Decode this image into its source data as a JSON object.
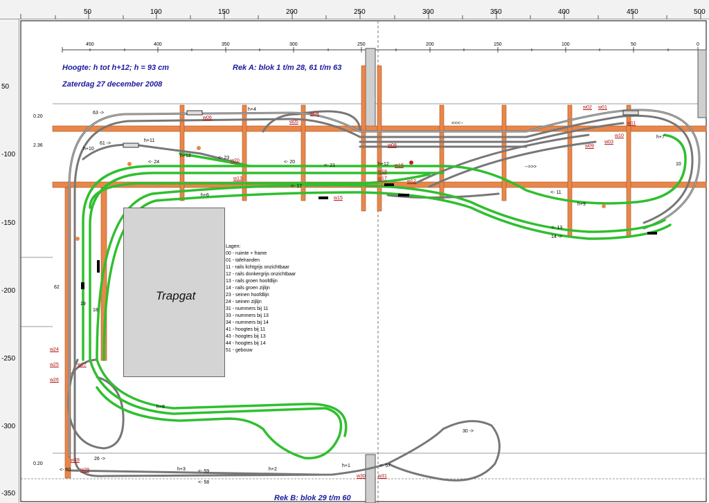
{
  "ruler_top": [
    "50",
    "100",
    "150",
    "200",
    "250",
    "300",
    "350",
    "400",
    "450",
    "500"
  ],
  "ruler_left": [
    "50",
    "-100",
    "-150",
    "-200",
    "-250",
    "-300",
    "-350"
  ],
  "inner_scale": [
    "450",
    "400",
    "350",
    "300",
    "250",
    "200",
    "150",
    "100",
    "50",
    "0"
  ],
  "header": {
    "hoogte": "Hoogte: h tot h+12;   h = 93 cm",
    "date": "Zaterdag 27 december 2008",
    "rek_a": "Rek A: blok 1 t/m 28, 61 t/m 63",
    "rek_b": "Rek B: blok 29 t/m 60"
  },
  "trapgat": "Trapgat",
  "legend": {
    "title": "Lagen:",
    "items": [
      "00 - ruimte + frame",
      "01 - tafelranden",
      "11 - rails lichtgrijs onzichtbaar",
      "12 - rails donkergrijs onzichtbaar",
      "13 - rails groen hoofdlijn",
      "14 - rails groen zijlijn",
      "23 - seinen hoofdlijn",
      "24 - seinen zijlijn",
      "31 - nummers bij 11",
      "33 - nummers bij 13",
      "34 - nummers bij 14",
      "41 - hoogtes bij 11",
      "43 - hoogtes bij 13",
      "44 - hoogtes bij 14",
      "51 - gebouw"
    ]
  },
  "side_marks": [
    "0.20",
    "2.36",
    "0.20"
  ],
  "switch_labels": [
    "w02",
    "w01",
    "w11",
    "w03",
    "w04",
    "w05",
    "w06",
    "w08",
    "w09",
    "w10",
    "w12",
    "w13",
    "w15",
    "w16",
    "w17",
    "w18",
    "w20",
    "w24",
    "w25",
    "w26",
    "w27",
    "w28",
    "w29",
    "w30",
    "w31"
  ],
  "track_labels": [
    "63 ->",
    "61 ->",
    "h+10",
    "h+11",
    "h+4",
    "h+6",
    "h+12",
    "<- 24",
    "<- 23",
    "<- 21",
    "<- 20",
    "<- 17",
    "<- 11",
    "<- 13",
    "14 ->",
    "h+9",
    "h+8",
    "h+2",
    "h+3",
    "h+1",
    "26 ->",
    "<- 60",
    "<- 59",
    "<- 58",
    "<- 57",
    "30 ->",
    "18",
    "19",
    "62",
    "h+12",
    "10",
    "<<<--",
    "-->>>",
    "h+7"
  ]
}
